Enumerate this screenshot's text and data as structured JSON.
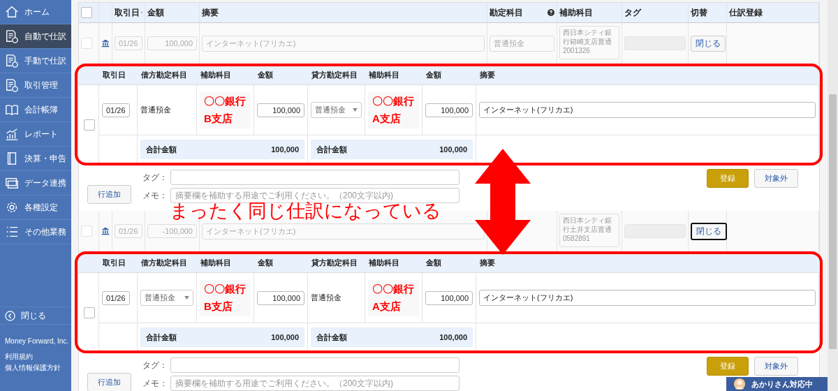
{
  "sidebar": {
    "items": [
      {
        "label": "ホーム",
        "selected": false
      },
      {
        "label": "自動で仕訳",
        "selected": true
      },
      {
        "label": "手動で仕訳",
        "selected": false
      },
      {
        "label": "取引管理",
        "selected": false
      },
      {
        "label": "会計帳簿",
        "selected": false
      },
      {
        "label": "レポート",
        "selected": false
      },
      {
        "label": "決算・申告",
        "selected": false
      },
      {
        "label": "データ連携",
        "selected": false
      },
      {
        "label": "各種設定",
        "selected": false
      },
      {
        "label": "その他業務",
        "selected": false
      }
    ],
    "close_label": "閉じる",
    "company": "Money Forward, Inc.",
    "links": [
      "利用規約",
      "個人情報保護方針"
    ]
  },
  "list_header": {
    "checked": false,
    "columns": [
      "取引日",
      "金額",
      "摘要",
      "勘定科目",
      "補助科目",
      "タグ",
      "切替",
      "仕訳登録"
    ]
  },
  "entries": [
    {
      "row": {
        "checked": false,
        "date": "01/26",
        "amount": "100,000",
        "description": "インターネット(フリカエ)",
        "account": "普通預金",
        "sub_account": [
          "西日本シティ銀",
          "行箱崎支店普通",
          "2001326"
        ],
        "close_button": "閉じる",
        "focused": false
      },
      "detail": {
        "headers": [
          "取引日",
          "借方勘定科目",
          "補助科目",
          "金額",
          "貸方勘定科目",
          "補助科目",
          "金額",
          "摘要"
        ],
        "checked": false,
        "date": "01/26",
        "debit_account": {
          "kind": "text",
          "text": "普通預金"
        },
        "debit_note": [
          "〇〇銀行",
          "B支店"
        ],
        "debit_amount": "100,000",
        "credit_account": {
          "kind": "select",
          "text": "普通預金"
        },
        "credit_note": [
          "〇〇銀行",
          "A支店"
        ],
        "credit_amount": "100,000",
        "description": "インターネット(フリカエ)",
        "debit_total_label": "合計金額",
        "debit_total": "100,000",
        "credit_total_label": "合計金額",
        "credit_total": "100,000"
      },
      "add_row": "行追加",
      "tag_label": "タグ：",
      "memo_label": "メモ：",
      "memo_placeholder": "摘要欄を補助する用途でご利用ください。（200文字以内)",
      "register": "登録",
      "exclude": "対象外"
    },
    {
      "row": {
        "checked": false,
        "date": "01/26",
        "amount": "-100,000",
        "description": "インターネット(フリカエ)",
        "sub_account": [
          "西日本シティ銀",
          "行土井支店普通",
          "0582891"
        ],
        "close_button": "閉じる",
        "focused": true
      },
      "detail": {
        "headers": [
          "取引日",
          "借方勘定科目",
          "補助科目",
          "金額",
          "貸方勘定科目",
          "補助科目",
          "金額",
          "摘要"
        ],
        "checked": false,
        "date": "01/26",
        "debit_account": {
          "kind": "select",
          "text": "普通預金"
        },
        "debit_note": [
          "〇〇銀行",
          "B支店"
        ],
        "debit_amount": "100,000",
        "credit_account": {
          "kind": "text",
          "text": "普通預金"
        },
        "credit_note": [
          "〇〇銀行",
          "A支店"
        ],
        "credit_amount": "100,000",
        "description": "インターネット(フリカエ)",
        "debit_total_label": "合計金額",
        "debit_total": "100,000",
        "credit_total_label": "合計金額",
        "credit_total": "100,000"
      },
      "add_row": "行追加",
      "tag_label": "タグ：",
      "memo_label": "メモ：",
      "memo_placeholder": "摘要欄を補助する用途でご利用ください。（200文字以内)",
      "register": "登録",
      "exclude": "対象外"
    }
  ],
  "annotation": "まったく同じ仕訳になっている",
  "chat_widget": "あかりさん対応中"
}
